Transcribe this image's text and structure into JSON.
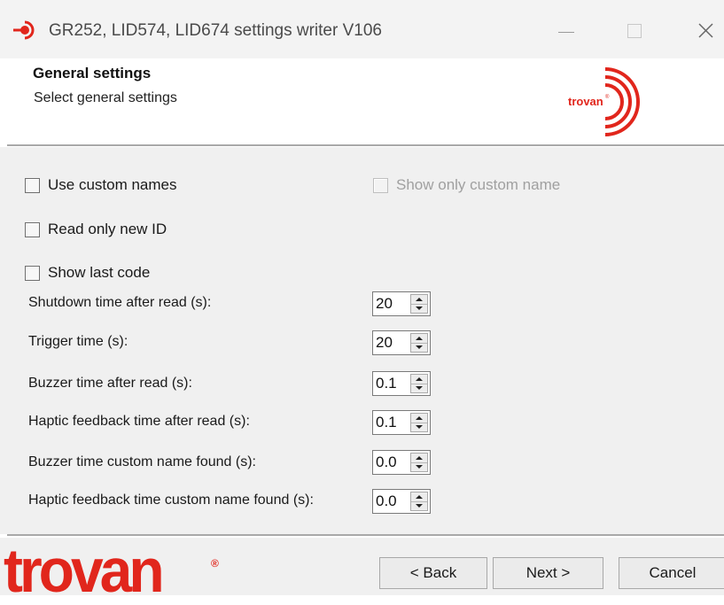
{
  "window": {
    "title": "GR252, LID574, LID674 settings writer V106",
    "app_icon": "trovan-icon",
    "controls": [
      "minimize-icon",
      "maximize-icon",
      "close-icon"
    ]
  },
  "header": {
    "title": "General settings",
    "subtitle": "Select general settings",
    "logo_text": "trovan",
    "logo_mark": "®"
  },
  "options": {
    "use_custom_names": {
      "label": "Use custom names",
      "checked": false
    },
    "show_only_custom_name": {
      "label": "Show only custom name",
      "checked": false,
      "enabled": false
    },
    "read_only_new_id": {
      "label": "Read only new ID",
      "checked": false
    },
    "show_last_code": {
      "label": "Show last code",
      "checked": false
    }
  },
  "fields": [
    {
      "label": "Shutdown time after read (s):",
      "value": "20"
    },
    {
      "label": "Trigger time (s):",
      "value": "20"
    },
    {
      "label": "Buzzer time after read (s):",
      "value": "0.1"
    },
    {
      "label": "Haptic feedback time after read (s):",
      "value": "0.1"
    },
    {
      "label": "Buzzer time custom name found (s):",
      "value": "0.0"
    },
    {
      "label": "Haptic feedback time custom name found (s):",
      "value": "0.0"
    }
  ],
  "footer": {
    "logo_text": "trovan",
    "logo_mark": "®",
    "back_label": "< Back",
    "next_label": "Next >",
    "cancel_label": "Cancel"
  },
  "colors": {
    "brand_red": "#e1261c",
    "dialog_bg": "#f0f0f0",
    "titlebar_bg": "#f3f3f3"
  }
}
